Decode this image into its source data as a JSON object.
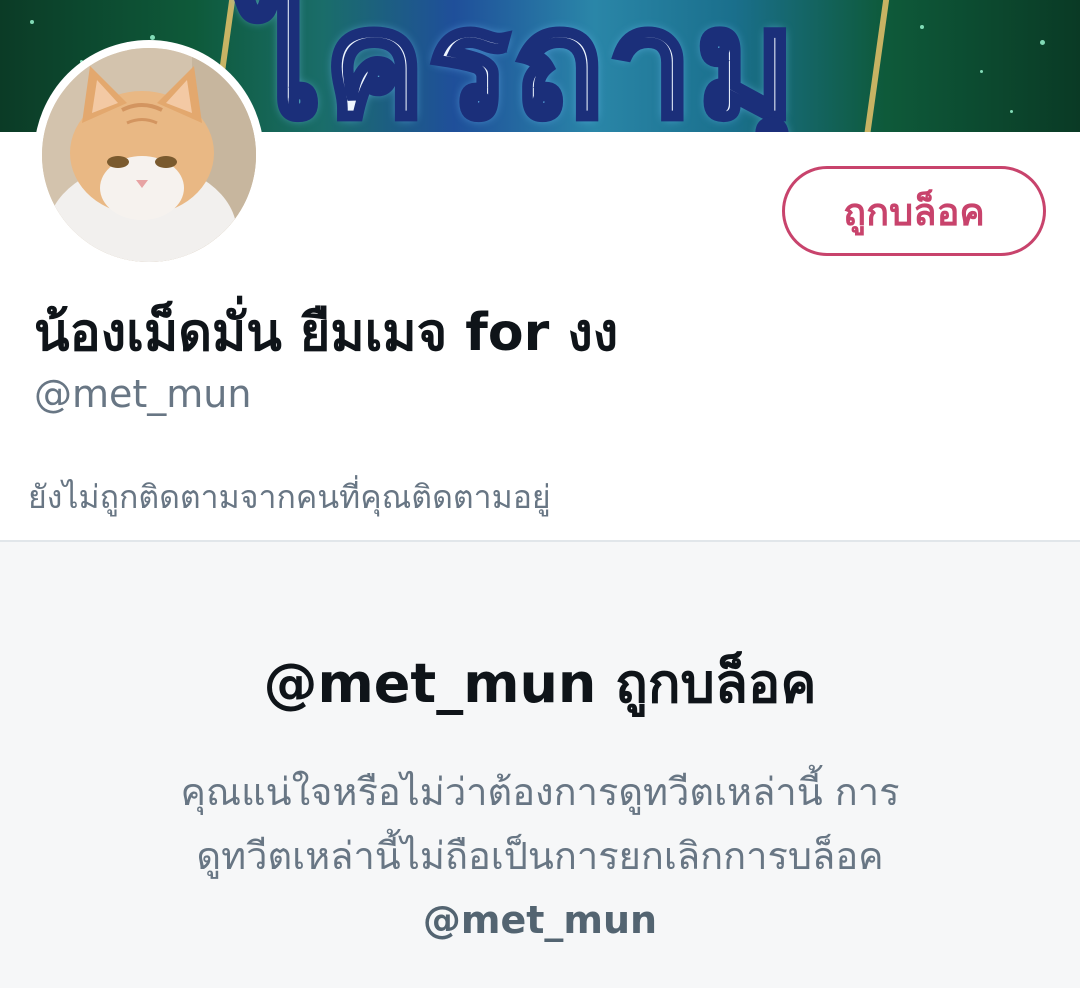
{
  "banner": {
    "logo_text": "ไครถามุ",
    "colors": {
      "primary": "#0e5a3a",
      "accent": "#2a86a8",
      "frame": "#e8c36a"
    }
  },
  "profile": {
    "display_name": "น้องเม็ดมั่น ยืมเมจ for งง",
    "handle": "@met_mun",
    "follow_info": "ยังไม่ถูกติดตามจากคนที่คุณติดตามอยู่",
    "avatar_icon": "cat-avatar-icon"
  },
  "actions": {
    "blocked_label": "ถูกบล็อค",
    "blocked_color": "#c8436c"
  },
  "blocked_notice": {
    "title": "@met_mun ถูกบล็อค",
    "desc_line_1": "คุณแน่ใจหรือไม่ว่าต้องการดูทวีตเหล่านี้ การ",
    "desc_line_2": "ดูทวีตเหล่านี้ไม่ถือเป็นการยกเลิกการบล็อค",
    "desc_handle": "@met_mun"
  }
}
